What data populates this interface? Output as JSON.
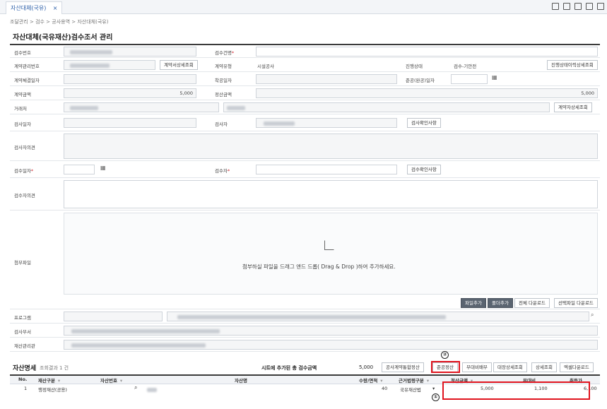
{
  "tab": {
    "title": "자산대체(국유)",
    "close": "×"
  },
  "breadcrumb": "조달관리 > 검수 > 공사용역 > 자산대체(국유)",
  "page_title": "자산대체(국유재산)검수조서 관리",
  "form": {
    "inspection_no_label": "검수번호",
    "inspection_name_label": "검수건명",
    "contract_no_label": "계약관리번호",
    "contract_detail_btn": "계약서상세조회",
    "contract_type_label": "계약유형",
    "contract_type_value": "시설공사",
    "progress_label": "진행상태",
    "progress_value": "검수-기안전",
    "progress_history_btn": "진행상태이력상세조회",
    "contract_date_label": "계약체결일자",
    "start_date_label": "착공일자",
    "completion_date_label": "준공(완공)일자",
    "contract_amount_label": "계약금액",
    "contract_amount_value": "5,000",
    "settle_amount_label": "정산금액",
    "settle_amount_value": "5,000",
    "vendor_label": "거래처",
    "vendor_detail_btn": "계약자상세조회",
    "inspect_date_label": "검사일자",
    "inspector_label": "검사자",
    "inspect_confirm_btn": "검사확인사항",
    "inspector_opinion_label": "검사자의견",
    "accept_date_label": "검수일자",
    "acceptor_label": "검수자",
    "accept_confirm_btn": "검수확인사항",
    "acceptor_opinion_label": "검수자의견",
    "attach_label": "첨부파일",
    "drop_text": "첨부하실 파일을 드래그 앤드 드롭( Drag & Drop )하여 추가하세요.",
    "btn_add_file": "파일추가",
    "btn_add_folder": "폴더추가",
    "btn_download_all": "전체 다운로드",
    "btn_download_selected": "선택파일 다운로드",
    "program_label": "프로그램",
    "inspect_dept_label": "검사부서",
    "asset_mgr_label": "재산관리관"
  },
  "asset_section": {
    "title": "자산명세",
    "count_text": "조회결과 1 건",
    "sum_label": "시트에 추가된 총 검수금액",
    "sum_value": "5,000",
    "buttons": [
      "공사계약통합정산",
      "준공정산",
      "부대비배부",
      "대장상세조회",
      "상세조회",
      "엑셀다운로드"
    ],
    "columns": [
      "No.",
      "재산구분",
      "자산번호",
      "자산명",
      "수량/면적",
      "근거법령구분",
      "정산금액",
      "부대비",
      "취득가"
    ],
    "rows": [
      {
        "no": "1",
        "category": "행정재산(공용)",
        "asset_no": "",
        "asset_name": "",
        "qty": "40",
        "law": "국유재산법",
        "settle": "5,000",
        "extra": "1,100",
        "acquire": "6,100"
      }
    ]
  },
  "annotations": {
    "one": "①",
    "two": "②"
  },
  "colors": {
    "accent": "#2c5fa8",
    "highlight": "#e0141e"
  }
}
